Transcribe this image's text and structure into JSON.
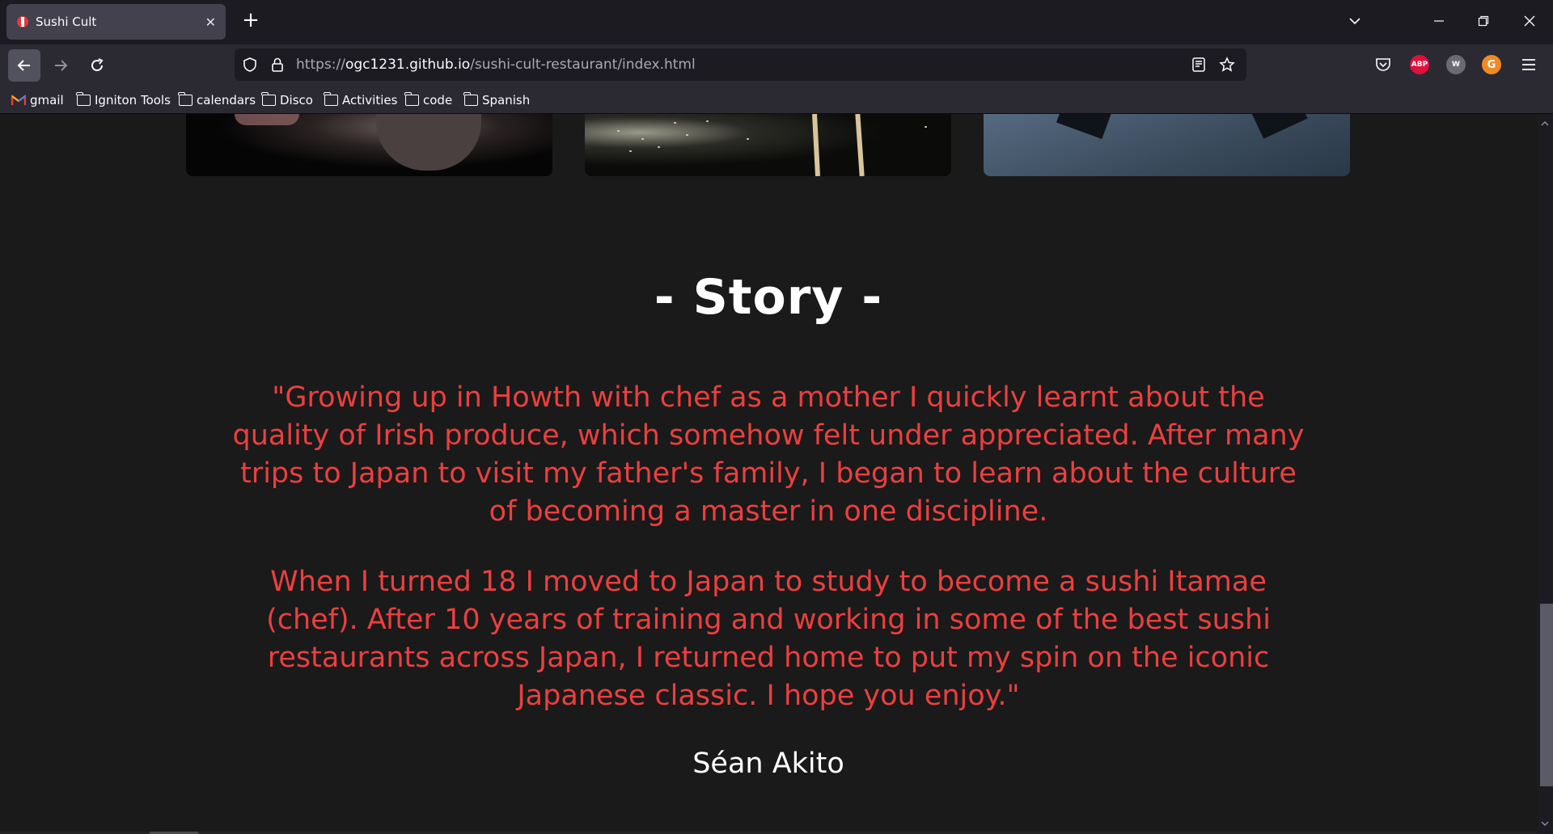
{
  "browser": {
    "tab": {
      "title": "Sushi Cult",
      "close_icon": "close-icon"
    },
    "new_tab_label": "+",
    "window_controls": {
      "minimize": "—",
      "restore": "❐",
      "close": "✕",
      "list_all_tabs": "⌄"
    },
    "url": {
      "scheme": "https://",
      "host": "ogc1231.github.io",
      "path": "/sushi-cult-restaurant/index.html"
    },
    "extensions": {
      "abp": "ABP",
      "w": "W",
      "g": "G"
    },
    "bookmarks": [
      "gmail",
      "Igniton Tools",
      "calendars",
      "Disco",
      "Activities",
      "code",
      "Spanish"
    ]
  },
  "story": {
    "title": "- Story -",
    "paragraph1": "\"Growing up in Howth with chef as a mother I quickly learnt about the quality of Irish produce, which somehow felt under appreciated. After many trips to Japan to visit my father's family, I began to learn about the culture of becoming a master in one discipline.",
    "paragraph2": "When I turned 18 I moved to Japan to study to become a sushi Itamae (chef). After 10 years of training and working in some of the best sushi restaurants across Japan, I returned home to put my spin on the iconic Japanese classic. I hope you enjoy.\"",
    "author": "Séan Akito"
  },
  "colors": {
    "page_bg": "#1a1a1a",
    "story_text": "#ec3f3f",
    "title_text": "#ffffff"
  }
}
